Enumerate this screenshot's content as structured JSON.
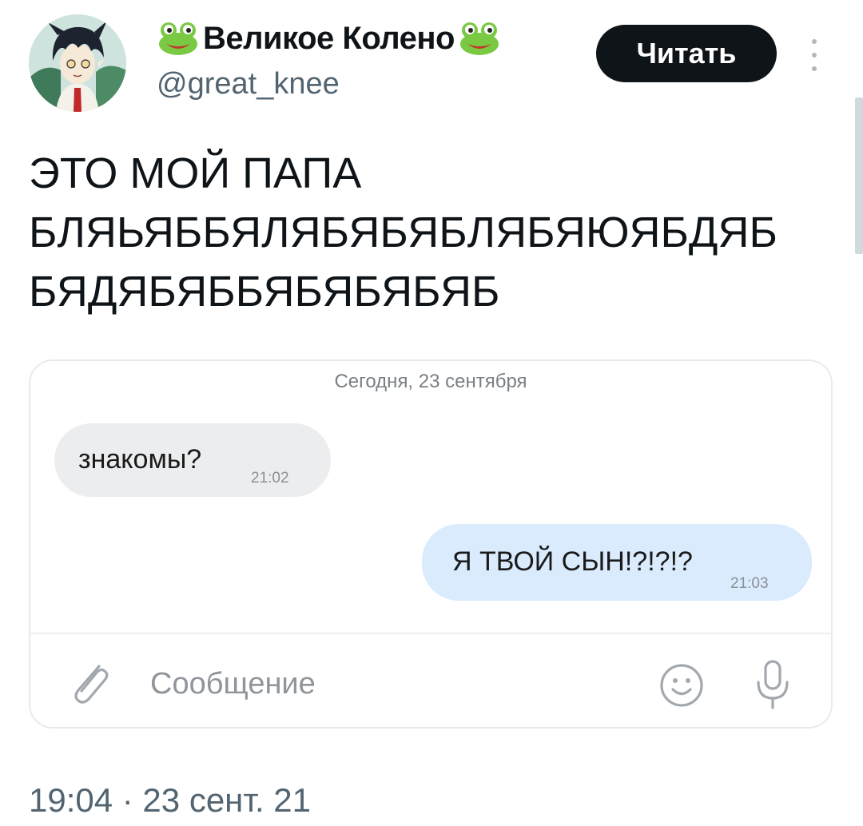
{
  "author": {
    "display_name": "Великое Колено",
    "handle": "@great_knee",
    "name_icon": "frog-emoji",
    "avatar_icon": "anime-character-avatar"
  },
  "header": {
    "follow_label": "Читать",
    "more_icon": "vertical-dots-icon"
  },
  "tweet": {
    "text": "ЭТО МОЙ ПАПА\nБЛЯЬЯББЯЛЯБЯБЯБЛЯБЯЮЯБДЯБ\nБЯДЯБЯББЯБЯБЯБЯБ",
    "timestamp": "19:04 · 23 сент. 21"
  },
  "chat": {
    "date_separator": "Сегодня, 23 сентября",
    "messages": [
      {
        "direction": "incoming",
        "text": "знакомы?",
        "time": "21:02"
      },
      {
        "direction": "outgoing",
        "text": "Я ТВОЙ СЫН!?!?!?",
        "time": "21:03"
      }
    ],
    "input_placeholder": "Сообщение",
    "icons": [
      "paperclip-icon",
      "emoji-icon",
      "microphone-icon"
    ]
  },
  "colors": {
    "follow_button": "#0f1419",
    "incoming_bubble": "#ecedef",
    "outgoing_bubble": "#d9ebfd",
    "secondary_text": "#536471"
  }
}
